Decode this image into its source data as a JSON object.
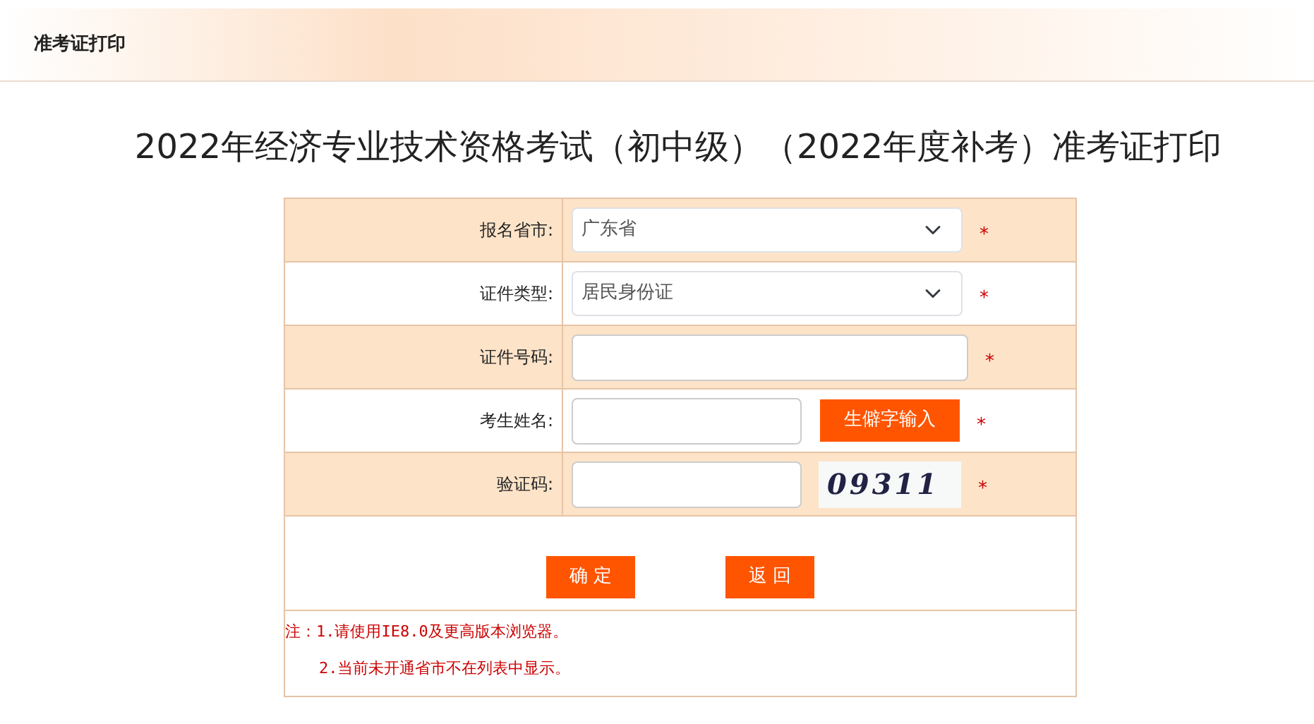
{
  "header": {
    "title": "准考证打印"
  },
  "page_title": "2022年经济专业技术资格考试（初中级）（2022年度补考）准考证打印",
  "form_rows": [
    {
      "kind": "select",
      "label": "报名省市:",
      "value": "广东省",
      "required_mark": "*"
    },
    {
      "kind": "select",
      "label": "证件类型:",
      "value": "居民身份证",
      "required_mark": "*"
    },
    {
      "kind": "input",
      "label": "证件号码:",
      "required_mark": "*"
    },
    {
      "kind": "input_button",
      "label": "考生姓名:",
      "button": "生僻字输入",
      "required_mark": "*"
    },
    {
      "kind": "captcha",
      "label": "验证码:",
      "captcha": "09311",
      "required_mark": "*"
    }
  ],
  "buttons": [
    "确 定",
    "返 回"
  ],
  "notes": [
    "注：1.请使用IE8.0及更高版本浏览器。",
    "2.当前未开通省市不在列表中显示。"
  ]
}
